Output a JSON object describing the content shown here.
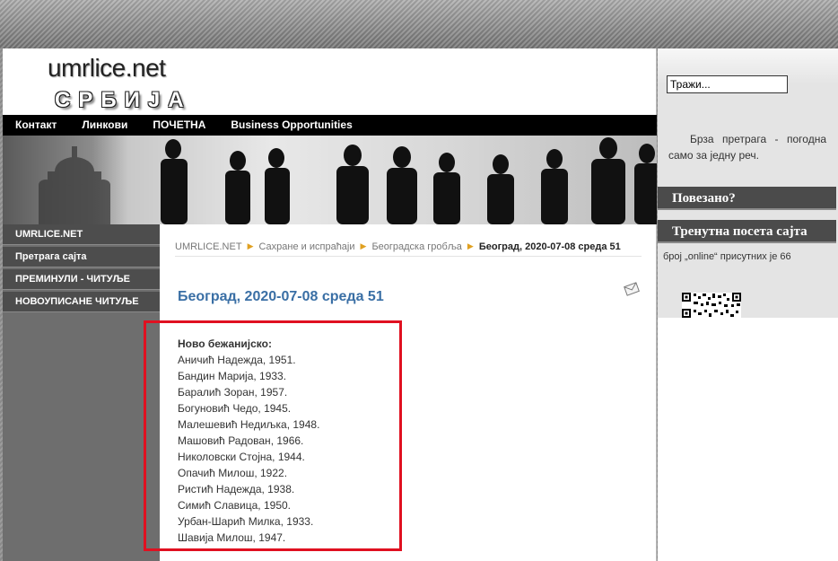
{
  "site": {
    "logo_main": "umrlice.net",
    "logo_sub": "СРБИЈА"
  },
  "nav": [
    {
      "label": "Контакт"
    },
    {
      "label": "Линкови"
    },
    {
      "label": "ПОЧЕТНА"
    },
    {
      "label": "Business Opportunities"
    }
  ],
  "sidebar": {
    "items": [
      {
        "label": "UMRLICE.NET"
      },
      {
        "label": "Претрага сајта"
      },
      {
        "label": "ПРЕМИНУЛИ - ЧИТУЉЕ"
      },
      {
        "label": "НОВОУПИСАНЕ ЧИТУЉЕ"
      }
    ]
  },
  "breadcrumb": {
    "items": [
      "UMRLICE.NET",
      "Сахране и испраћаји",
      "Београдска гробља"
    ],
    "current": "Београд, 2020-07-08 среда 51"
  },
  "article": {
    "title": "Београд, 2020-07-08 среда 51",
    "heading": "Ново бежанијско:",
    "entries": [
      "Аничић Надежда, 1951.",
      "Бандин Марија, 1933.",
      "Баралић Зоран, 1957.",
      "Богуновић Чедо, 1945.",
      "Малешевић Недиљка, 1948.",
      "Машовић Радован, 1966.",
      "Николовски Стојна, 1944.",
      "Опачић Милош, 1922.",
      "Ристић Надежда, 1938.",
      "Симић Славица, 1950.",
      "Урбан-Шарић Милка, 1933.",
      "Шавија Милош, 1947."
    ]
  },
  "right_column": {
    "search_value": "Тражи...",
    "quick_search_text": "Брза претрага - погодна само за једну реч.",
    "box_related": "Повезано?",
    "box_visits": "Тренутна посета сајта",
    "online_text": "број „online“ присутних је 66"
  },
  "colors": {
    "accent": "#3a6fa5",
    "highlight": "#e01020",
    "breadcrumb_arrow": "#e0a020"
  }
}
